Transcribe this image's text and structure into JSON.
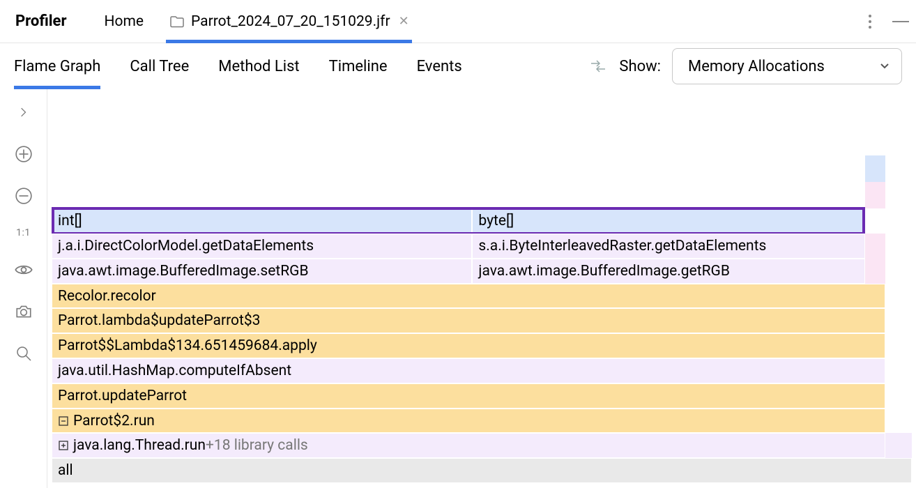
{
  "topbar": {
    "title": "Profiler",
    "tabs": [
      {
        "label": "Home"
      },
      {
        "label": "Parrot_2024_07_20_151029.jfr"
      }
    ]
  },
  "secondbar": {
    "tabs": [
      {
        "label": "Flame Graph"
      },
      {
        "label": "Call Tree"
      },
      {
        "label": "Method List"
      },
      {
        "label": "Timeline"
      },
      {
        "label": "Events"
      }
    ],
    "show_label": "Show:",
    "select_value": "Memory Allocations"
  },
  "gutter": {
    "ratio": "1:1"
  },
  "frames": {
    "all": "all",
    "thread_run": "java.lang.Thread.run",
    "thread_suffix": "  +18 library calls",
    "parrot2_run": "Parrot$2.run",
    "updateParrot": "Parrot.updateParrot",
    "computeIfAbsent": "java.util.HashMap.computeIfAbsent",
    "lambda134": "Parrot$$Lambda$134.651459684.apply",
    "lambda3": "Parrot.lambda$updateParrot$3",
    "recolor": "Recolor.recolor",
    "setRGB": "java.awt.image.BufferedImage.setRGB",
    "getRGB": "java.awt.image.BufferedImage.getRGB",
    "directColor": "j.a.i.DirectColorModel.getDataElements",
    "byteRaster": "s.a.i.ByteInterleavedRaster.getDataElements",
    "int_arr": "int[]",
    "byte_arr": "byte[]"
  }
}
